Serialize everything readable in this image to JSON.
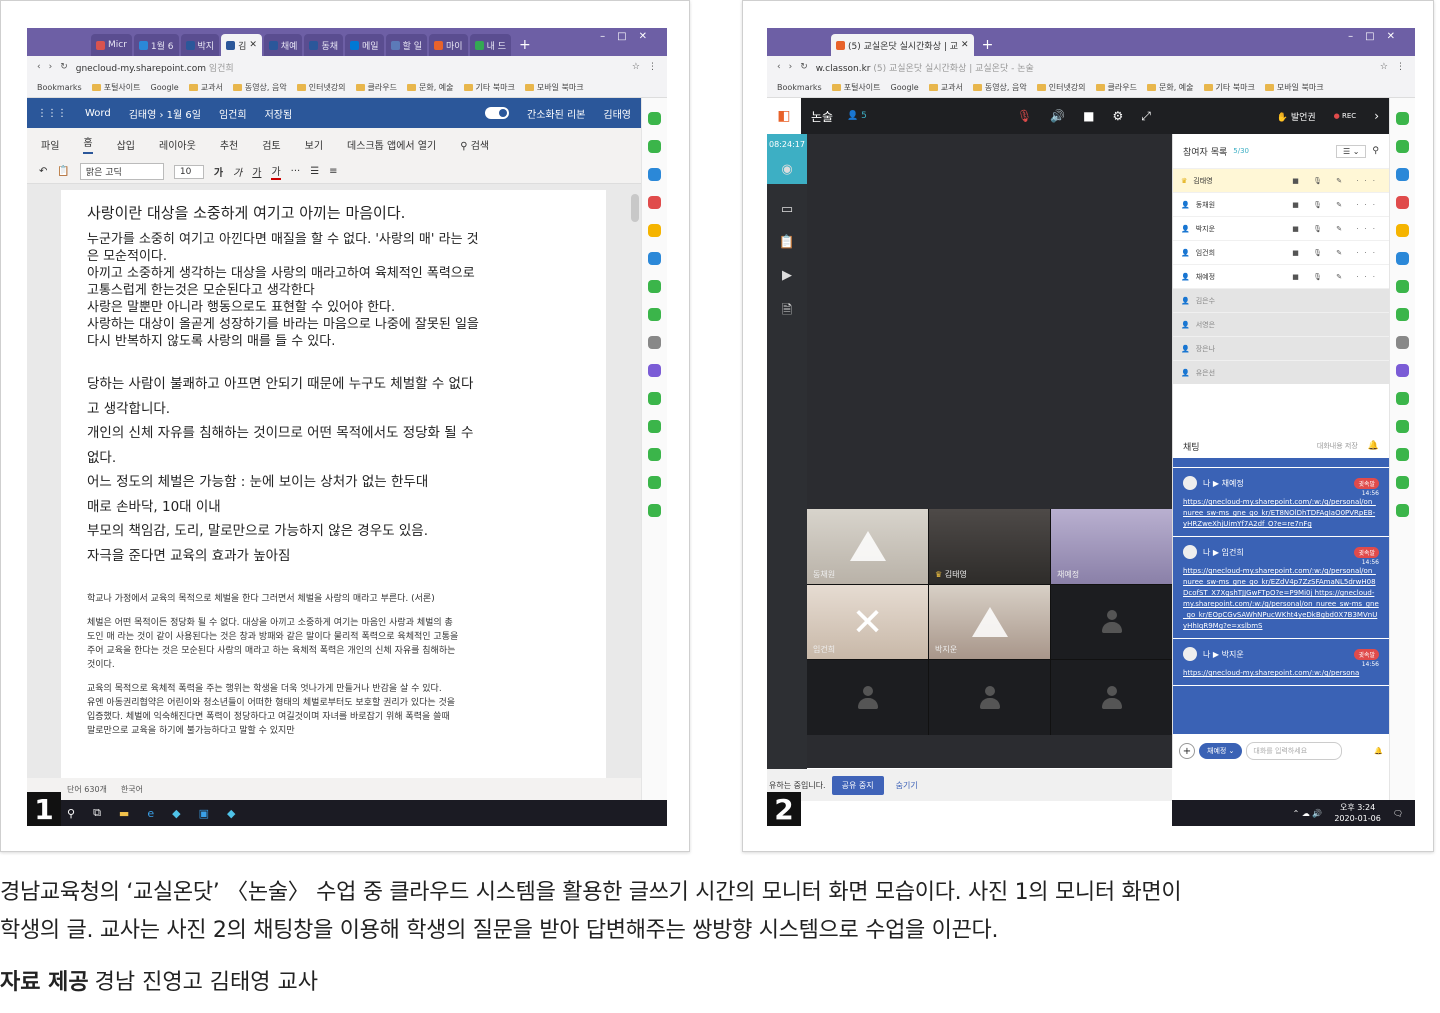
{
  "panel1": {
    "badge": "1",
    "browser": {
      "tabs": [
        "Micr",
        "1월 6",
        "박지",
        "김",
        "채예",
        "동채",
        "메일",
        "할 일",
        "마이",
        "내 드"
      ],
      "url": "gnecloud-my.sharepoint.com",
      "url_tail": "임건희",
      "bookmarks": [
        "Bookmarks",
        "포털사이트",
        "Google",
        "교과서",
        "동영상, 음악",
        "인터넷강의",
        "클라우드",
        "문화, 예술",
        "기타 북마크",
        "모바일 북마크"
      ]
    },
    "word": {
      "app": "Word",
      "doc_title": "김태영 › 1월 6일",
      "author": "임건희",
      "saved": "저장됨",
      "simplified_ribbon": "간소화된 리본",
      "user": "김태영",
      "ribbon_tabs": [
        "파일",
        "홈",
        "삽입",
        "레이아웃",
        "추천",
        "검토",
        "보기",
        "데스크톱 앱에서 열기",
        "검색"
      ],
      "font_name": "맑은 고딕",
      "font_size": "10",
      "statusbar": [
        "단어 630개",
        "한국어"
      ]
    },
    "doc": {
      "heading": "사랑이란 대상을 소중하게 여기고 아끼는 마음이다.",
      "para1": [
        "누군가를 소중히 여기고 아낀다면 매질을 할 수 없다. '사랑의 매' 라는 것",
        "은 모순적이다.",
        "아끼고 소중하게 생각하는 대상을 사랑의 매라고하여 육체적인 폭력으로",
        "고통스럽게 한는것은 모순된다고 생각한다",
        "사랑은 말뿐만 아니라 행동으로도 표현할 수 있어야 한다.",
        "사랑하는 대상이 올곧게 성장하기를 바라는 마음으로 나중에 잘못된 일을",
        "다시 반복하지 않도록 사랑의 매를 들 수 있다."
      ],
      "para2": [
        "당하는 사람이 불쾌하고 아프면 안되기 때문에 누구도 체벌할 수 없다",
        "고 생각합니다.",
        "개인의 신체 자유를 침해하는 것이므로 어떤 목적에서도 정당화 될 수",
        "없다.",
        "어느 정도의 체벌은 가능함 : 눈에 보이는 상처가 없는 한두대",
        "매로 손바닥, 10대 이내",
        "부모의 책임감, 도리, 말로만으로 가능하지 않은 경우도 있음.",
        "자극을 준다면 교육의 효과가 높아짐"
      ],
      "small1": "학교나 가정에서 교육의 목적으로 체벌을 한다 그러면서 체벌을 사랑의 매라고 부른다. (서론)",
      "small2": [
        "체벌은 어떤 목적이든 정당화 될 수 없다. 대상을 아끼고 소중하게 여기는 마음인 사랑과 체벌의 총",
        "도인 매 라는 것이 같이 사용된다는 것은 창과 방패와 같은 말이다 물리적 폭력으로 육체적인 고통을",
        "주어 교육을 한다는 것은 모순된다 사랑의 매라고 하는 육체적 폭력은 개인의 신체 자유를 침해하는",
        "것이다."
      ],
      "small3": [
        "교육의 목적으로 육체적 폭력을 주는 행위는 학생을 더욱 엇나가게 만들거나 반감을 살 수 있다.",
        "유엔 아동권리협약은 어린이와 청소년들이 어떠한 형태의 체벌로부터도 보호할 권리가 있다는 것을",
        "입증했다. 체벌에 익숙해진다면 폭력이 정당하다고 여길것이며 자녀를 바로잡기 위해 폭력을 쓸때",
        "말로만으로 교육을 하기에 불가능하다고 말할 수 있지만"
      ]
    }
  },
  "panel2": {
    "badge": "2",
    "browser": {
      "tab": "(5) 교실온닷 실시간화상 | 교",
      "url": "w.classon.kr",
      "url_tail": "(5) 교실온닷 실시간화상 | 교실온닷 - 논술",
      "bookmarks": [
        "Bookmarks",
        "포털사이트",
        "Google",
        "교과서",
        "동영상, 음악",
        "인터넷강의",
        "클라우드",
        "문화, 예술",
        "기타 북마크",
        "모바일 북마크"
      ]
    },
    "classroom": {
      "room": "논술",
      "count": "5",
      "speaker": "발언권",
      "rec": "REC",
      "timer": "08:24:17",
      "participants_title": "참여자 목록",
      "participants_count": "5/30",
      "participants": [
        {
          "name": "김태영",
          "state": "host"
        },
        {
          "name": "동채원",
          "state": "on"
        },
        {
          "name": "박지운",
          "state": "on"
        },
        {
          "name": "임건희",
          "state": "on"
        },
        {
          "name": "채예정",
          "state": "on"
        },
        {
          "name": "김은수",
          "state": "off"
        },
        {
          "name": "서영은",
          "state": "off"
        },
        {
          "name": "장은나",
          "state": "off"
        },
        {
          "name": "유은선",
          "state": "off"
        }
      ],
      "video_names": [
        "동채원",
        "김태영",
        "채예정",
        "임건희",
        "박지운"
      ],
      "share_status": "유하는 중입니다.",
      "stop_share": "공유 중지",
      "hide": "숨기기"
    },
    "chat": {
      "title": "채팅",
      "save": "대화내용 저장",
      "messages": [
        {
          "who": "나 ▶ 채예정",
          "tag": "귓속말",
          "time": "14:56",
          "text": "https://gnecloud-my.sharepoint.com/:w:/g/personal/on_nuree_sw-ms_gne_go_kr/ET8NOlDhTDFAgIaO0PVRpEB-yHRZweXhjUimYf7A2df_O?e=re7nFg"
        },
        {
          "who": "나 ▶ 임건희",
          "tag": "귓속말",
          "time": "14:56",
          "text": "https://gnecloud-my.sharepoint.com/:w:/g/personal/on_nuree_sw-ms_gne_go_kr/EZdV4p7ZzSFAmaNL5drwH08DcofST_X7XgshTJJGwFTpO?e=P9Mi0j https://gnecloud-my.sharepoint.com/:w:/g/personal/on_nuree_sw-ms_gne_go_kr/EOpCGvSAWhNPucWKht4yeDkBgbd0X7B3MVnUyHhIqR9Mg?e=xslbmS"
        },
        {
          "who": "나 ▶ 박지운",
          "tag": "귓속말",
          "time": "14:56",
          "text": "https://gnecloud-my.sharepoint.com/:w:/g/persona"
        }
      ],
      "target": "채예정",
      "placeholder": "대화를 입력하세요"
    },
    "clock": "오후 3:24",
    "date": "2020-01-06"
  },
  "caption": {
    "line1": "경남교육청의 ‘교실온닷’ 〈논술〉 수업 중 클라우드 시스템을 활용한 글쓰기 시간의 모니터 화면 모습이다. 사진 1의 모니터 화면이",
    "line2": "학생의 글. 교사는 사진 2의 채팅창을 이용해 학생의 질문을 받아 답변해주는 쌍방향 시스템으로 수업을 이끈다.",
    "credit_label": "자료 제공",
    "credit_text": "경남 진영고 김태영 교사"
  }
}
